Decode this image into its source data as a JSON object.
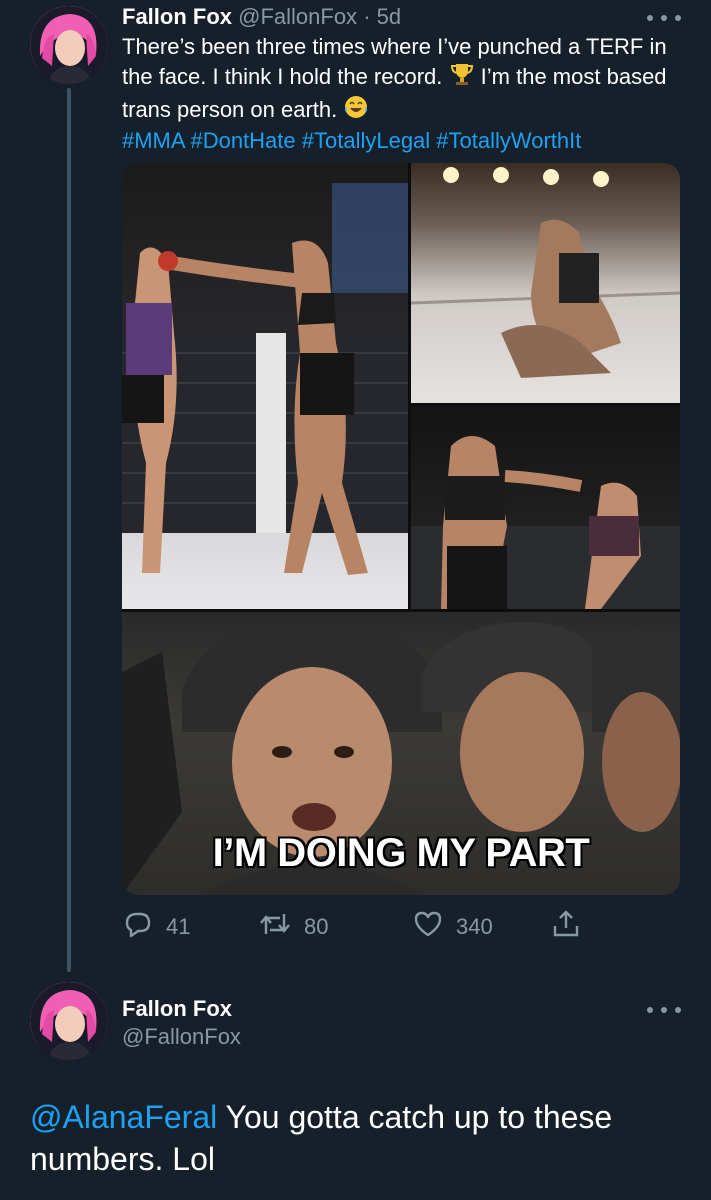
{
  "colors": {
    "background": "#15202b",
    "text": "#ffffff",
    "secondary": "#8899a6",
    "link": "#1da1f2"
  },
  "tweet": {
    "display_name": "Fallon Fox",
    "handle": "@FallonFox",
    "separator": "·",
    "time": "5d",
    "text_part1": "There’s been three times where I’ve punched a TERF in the face. I think I hold the record.",
    "emoji1": "trophy-emoji",
    "text_part2": "I’m the most based trans person on earth.",
    "emoji2": "tears-of-joy-emoji",
    "hashtags": "#MMA #DontHate #TotallyLegal #TotallyWorthIt",
    "media": {
      "images": [
        "mma-fight-photo",
        "mma-ground-fight-photo",
        "mma-punch-photo",
        "soldiers-meme-photo"
      ],
      "meme_caption": "I’M DOING MY PART"
    },
    "actions": {
      "reply_count": "41",
      "retweet_count": "80",
      "like_count": "340"
    }
  },
  "reply": {
    "display_name": "Fallon Fox",
    "handle": "@FallonFox",
    "mention": "@AlanaFeral",
    "text": " You gotta catch up to these numbers. Lol"
  }
}
